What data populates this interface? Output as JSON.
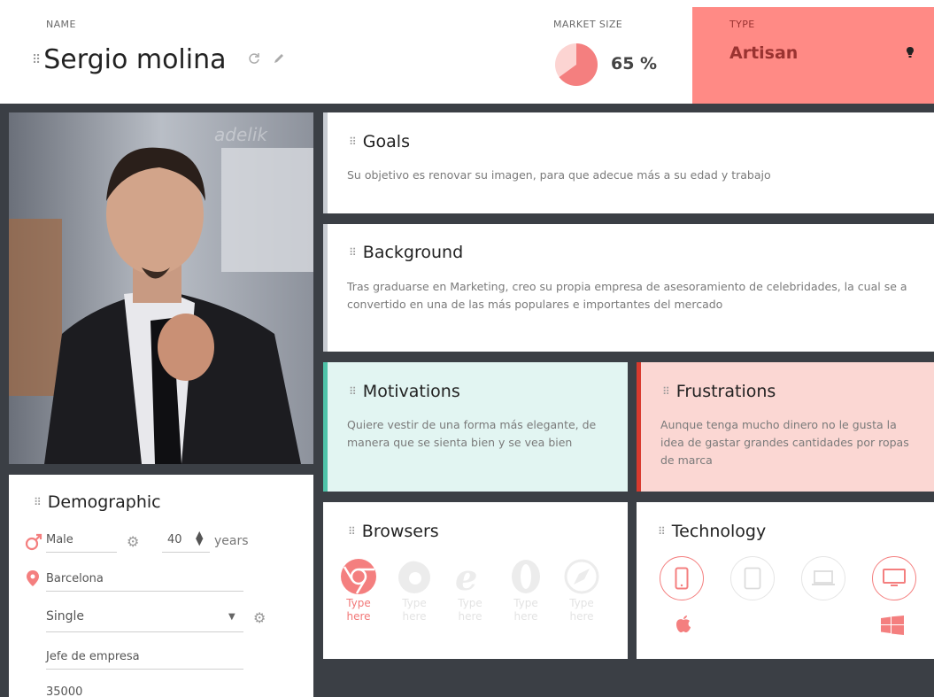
{
  "header": {
    "name_label": "NAME",
    "name_value": "Sergio molina",
    "market_label": "MARKET SIZE",
    "market_value": "65 %",
    "market_percent": 65,
    "type_label": "TYPE",
    "type_value": "Artisan"
  },
  "photo": {
    "watermark": "adelik"
  },
  "goals": {
    "title": "Goals",
    "text": "Su objetivo es renovar su imagen, para que adecue más a su edad y trabajo"
  },
  "background": {
    "title": "Background",
    "text": "Tras graduarse en Marketing, creo su propia empresa de asesoramiento de celebridades, la cual se a convertido en una de las más populares e importantes del mercado"
  },
  "motivations": {
    "title": "Motivations",
    "text": "Quiere vestir de una forma más elegante, de manera que se sienta bien y se vea bien"
  },
  "frustrations": {
    "title": "Frustrations",
    "text": "Aunque tenga mucho dinero no le gusta la idea de gastar grandes cantidades por ropas de marca"
  },
  "browsers": {
    "title": "Browsers",
    "items": [
      {
        "icon": "chrome-icon",
        "label": "Type here",
        "active": true
      },
      {
        "icon": "firefox-icon",
        "label": "Type here",
        "active": false
      },
      {
        "icon": "internet-explorer-icon",
        "label": "Type here",
        "active": false
      },
      {
        "icon": "opera-icon",
        "label": "Type here",
        "active": false
      },
      {
        "icon": "safari-icon",
        "label": "Type here",
        "active": false
      }
    ]
  },
  "technology": {
    "title": "Technology",
    "devices": [
      {
        "icon": "smartphone-icon",
        "active": true
      },
      {
        "icon": "tablet-icon",
        "active": false
      },
      {
        "icon": "laptop-icon",
        "active": false
      },
      {
        "icon": "desktop-icon",
        "active": true
      }
    ],
    "os": [
      "apple-icon",
      "windows-icon"
    ]
  },
  "demographic": {
    "title": "Demographic",
    "gender": "Male",
    "age": "40",
    "age_unit": "years",
    "location": "Barcelona",
    "status": "Single",
    "occupation": "Jefe de empresa",
    "income": "35000"
  },
  "colors": {
    "accent": "#f47f7f",
    "type_bg": "#ff8a85",
    "motivations_bg": "#e2f5f2",
    "motivations_border": "#4fc3a9",
    "frustrations_bg": "#fbd7d3",
    "frustrations_border": "#d83a2e",
    "app_bg": "#3b3f45"
  }
}
